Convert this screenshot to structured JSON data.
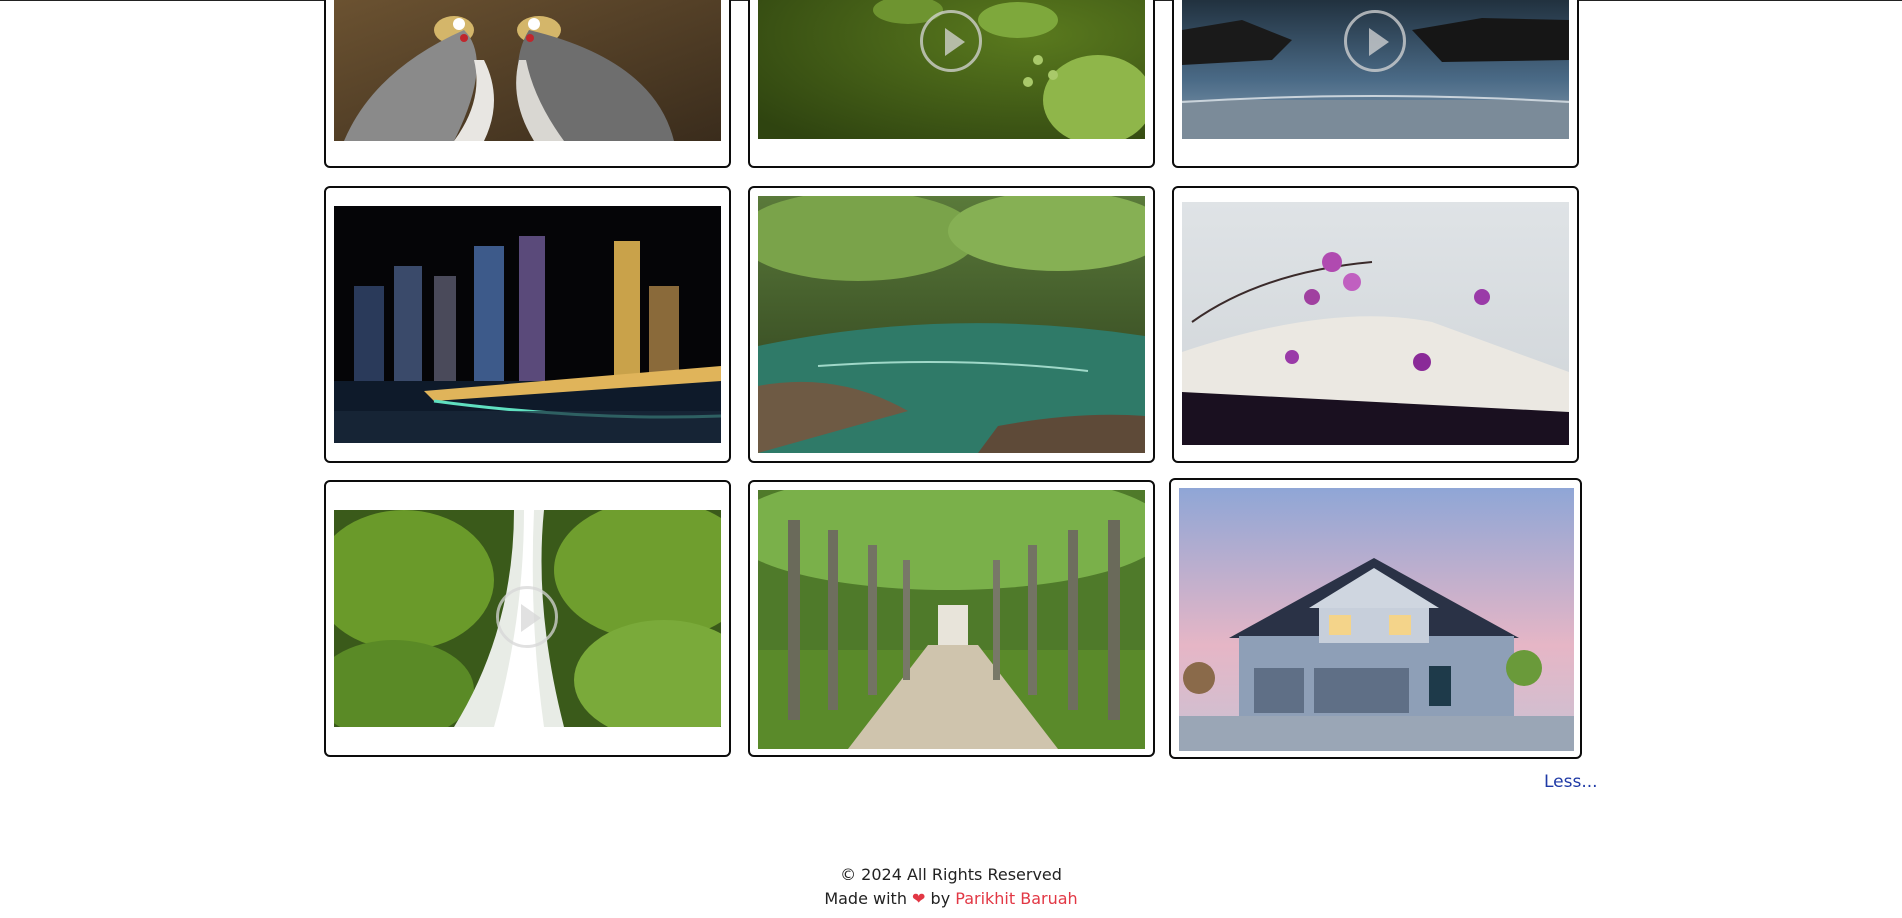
{
  "gallery": {
    "items": [
      {
        "alt": "crowned-cranes",
        "has_play": false
      },
      {
        "alt": "green-leaves",
        "has_play": true
      },
      {
        "alt": "rocky-shore",
        "has_play": true
      },
      {
        "alt": "city-night-bridge",
        "has_play": false
      },
      {
        "alt": "forest-river",
        "has_play": false
      },
      {
        "alt": "flowers-on-book",
        "has_play": false
      },
      {
        "alt": "waterfall",
        "has_play": true
      },
      {
        "alt": "tree-lined-path",
        "has_play": false
      },
      {
        "alt": "suburban-house",
        "has_play": false
      }
    ],
    "less_label": "Less..."
  },
  "footer": {
    "copyright": "© 2024 All Rights Reserved",
    "made_with": "Made with",
    "heart": "❤",
    "by": "by",
    "author": "Parikhit Baruah"
  },
  "colors": {
    "link": "#1f3aa6",
    "accent": "#e23744",
    "border": "#0c0c0c"
  }
}
